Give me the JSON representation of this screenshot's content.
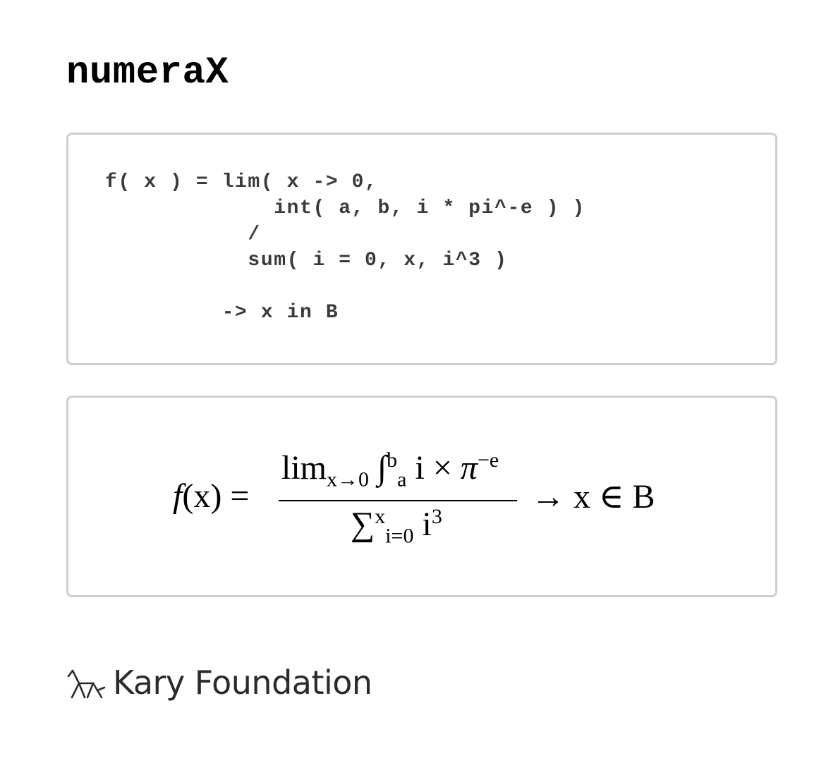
{
  "app": {
    "title": "numeraX"
  },
  "code_panel": {
    "code": "f( x ) = lim( x -> 0,\n             int( a, b, i * pi^-e ) )\n           /\n           sum( i = 0, x, i^3 )\n\n         -> x in B"
  },
  "render_panel": {
    "lhs_func": "f",
    "lhs_rest": "(x) =",
    "num_lim": "lim",
    "num_lim_sub": "x→0",
    "num_int": "∫",
    "num_int_sub": "a",
    "num_int_sup": "b",
    "num_body": " i × ",
    "num_pi": "π",
    "num_pi_sup": "−e",
    "den_sum": "∑",
    "den_sum_sub": "i=0",
    "den_sum_sup": "x",
    "den_body": " i",
    "den_body_sup": "3",
    "rhs": "→ x ∈ B"
  },
  "footer": {
    "brand_name": "Kary Foundation",
    "logo_icon": "kary-logo-icon"
  }
}
